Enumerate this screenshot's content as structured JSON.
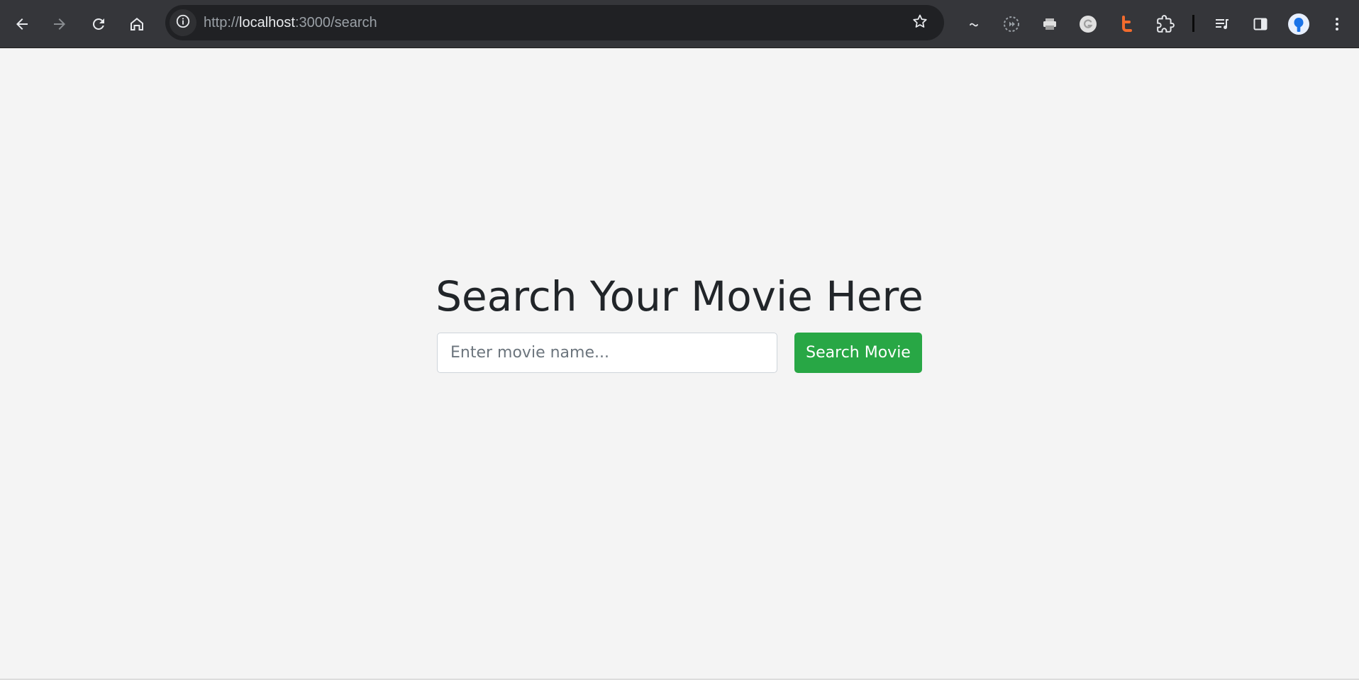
{
  "browser": {
    "url_scheme": "http://",
    "url_host": "localhost",
    "url_rest": ":3000/search",
    "icons": {
      "back": "arrow-left-icon",
      "forward": "arrow-right-icon",
      "reload": "reload-icon",
      "home": "home-icon",
      "site_info": "info-icon",
      "bookmark": "star-icon",
      "extensions": [
        "tilde-icon",
        "dashed-circle-icon",
        "printer-icon",
        "grammarly-icon",
        "t-extension-icon",
        "puzzle-icon"
      ],
      "media": "media-control-icon",
      "side_panel": "side-panel-icon",
      "profile": "avatar",
      "menu": "kebab-menu-icon"
    }
  },
  "page": {
    "heading": "Search Your Movie Here",
    "search": {
      "placeholder": "Enter movie name...",
      "value": "",
      "button_label": "Search Movie"
    }
  },
  "colors": {
    "toolbar_bg": "#35363a",
    "omnibox_bg": "#202124",
    "page_bg": "#f4f4f4",
    "button_bg": "#28a745",
    "heading_text": "#212529",
    "extension_orange": "#f26b2d"
  }
}
